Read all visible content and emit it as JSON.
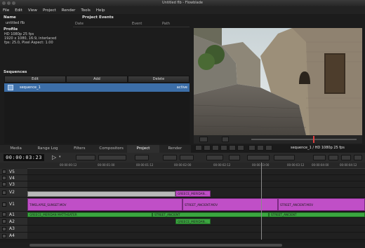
{
  "window": {
    "title": "Untitled flb - Flowblade"
  },
  "menu": [
    "File",
    "Edit",
    "View",
    "Project",
    "Render",
    "Tools",
    "Help"
  ],
  "project": {
    "name_label": "Name",
    "name_value": "untitled flb",
    "profile_label": "Profile",
    "profile_lines": [
      "HD 1080p 25 fps",
      "1920 x 1080, 16:9, interlaced",
      "fps: 25.0, Pixel Aspect: 1.00"
    ]
  },
  "events": {
    "title": "Project Events",
    "columns": [
      "Date",
      "Event",
      "Path"
    ]
  },
  "sequences": {
    "title": "Sequences",
    "buttons": [
      "Edit",
      "Add",
      "Delete"
    ],
    "items": [
      {
        "name": "sequence_1",
        "status": "active"
      }
    ]
  },
  "monitor": {
    "info": "sequence_1 / HD 1080p 25 fps"
  },
  "tabs": [
    "Media",
    "Range Log",
    "Filters",
    "Compositors",
    "Project",
    "Render"
  ],
  "active_tab": "Project",
  "timecode": "00:00:03:23",
  "ruler": [
    "00:00:00:12",
    "00:00:01:00",
    "00:00:01:12",
    "00:00:02:00",
    "00:00:02:12",
    "00:00:03:00",
    "00:00:03:12",
    "00:00:04:00",
    "00:00:04:12"
  ],
  "tracks": [
    "V5",
    "V4",
    "V3",
    "V2",
    "V1",
    "A1",
    "A2",
    "A3",
    "A4"
  ],
  "clips": {
    "v2_1": "GREECE_MERIDAN...",
    "v1_1": "TIMELAPSE_SUNSET.MOV",
    "v1_2": "STREET_ANCIENT.MOV",
    "v1_3": "STREET_ANCIENT.MOV",
    "a1_1": "GREECE_MERIDAN MATTHEATER",
    "a1_2": "STREET_ANCIENT",
    "a1_3": "STREET_ANCIENT",
    "a2_1": "GREECE_MERIDAN..."
  }
}
